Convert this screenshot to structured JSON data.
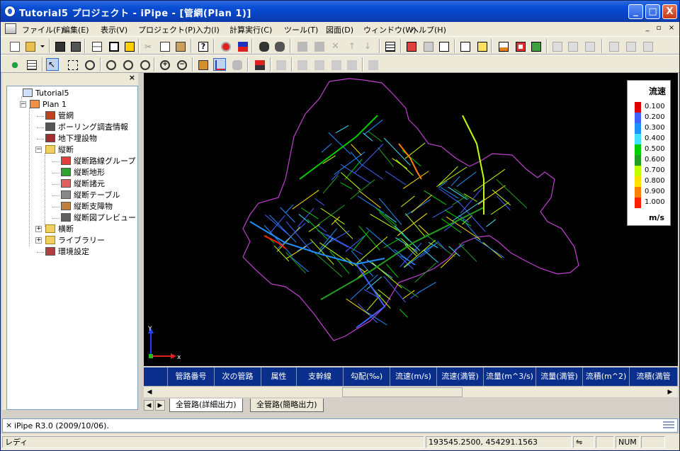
{
  "window": {
    "title": "Tutorial5 プロジェクト - iPipe - [管網(Plan 1)]",
    "buttons": {
      "minimize": "_",
      "maximize": "□",
      "close": "X"
    }
  },
  "menu": {
    "items": [
      "ファイル(F)",
      "編集(E)",
      "表示(V)",
      "プロジェクト(P)",
      "入力(I)",
      "計算実行(C)",
      "ツール(T)",
      "図面(D)",
      "ウィンドウ(W)",
      "ヘルプ(H)"
    ],
    "mdi": [
      "_",
      "▫",
      "×"
    ]
  },
  "left_panel": {
    "close": "×",
    "tree": [
      {
        "label": "Tutorial5",
        "icon": "project-icon",
        "level": 0,
        "expander": ""
      },
      {
        "label": "Plan 1",
        "icon": "plan-icon",
        "level": 1,
        "expander": "−"
      },
      {
        "label": "管網",
        "icon": "network-icon",
        "level": 2,
        "expander": ""
      },
      {
        "label": "ボーリング調査情報",
        "icon": "boring-icon",
        "level": 2,
        "expander": ""
      },
      {
        "label": "地下埋設物",
        "icon": "buried-icon",
        "level": 2,
        "expander": ""
      },
      {
        "label": "縦断",
        "icon": "folder-icon",
        "level": 2,
        "expander": "−"
      },
      {
        "label": "縦断路線グループ",
        "icon": "route-group-icon",
        "level": 3,
        "expander": ""
      },
      {
        "label": "縦断地形",
        "icon": "terrain-icon",
        "level": 3,
        "expander": ""
      },
      {
        "label": "縦断諸元",
        "icon": "spec-icon",
        "level": 3,
        "expander": ""
      },
      {
        "label": "縦断テーブル",
        "icon": "table-icon",
        "level": 3,
        "expander": ""
      },
      {
        "label": "縦断支障物",
        "icon": "obstacle-icon",
        "level": 3,
        "expander": ""
      },
      {
        "label": "縦断図プレビュー",
        "icon": "preview-icon",
        "level": 3,
        "expander": ""
      },
      {
        "label": "横断",
        "icon": "folder-icon",
        "level": 2,
        "expander": "+"
      },
      {
        "label": "ライブラリー",
        "icon": "folder-icon",
        "level": 2,
        "expander": "+"
      },
      {
        "label": "環境設定",
        "icon": "settings-icon",
        "level": 2,
        "expander": ""
      }
    ]
  },
  "legend": {
    "title": "流速",
    "unit": "m/s",
    "items": [
      {
        "label": "0.100",
        "color": "#e00000"
      },
      {
        "label": "0.200",
        "color": "#4060ff"
      },
      {
        "label": "0.300",
        "color": "#2090ff"
      },
      {
        "label": "0.400",
        "color": "#40e0ff"
      },
      {
        "label": "0.500",
        "color": "#00d000"
      },
      {
        "label": "0.600",
        "color": "#20a020"
      },
      {
        "label": "0.700",
        "color": "#c0ff00"
      },
      {
        "label": "0.800",
        "color": "#ffe000"
      },
      {
        "label": "0.900",
        "color": "#ff8000"
      },
      {
        "label": "1.000",
        "color": "#ff2000"
      }
    ]
  },
  "axes": {
    "y": "Y",
    "x": "x"
  },
  "grid": {
    "columns": [
      "",
      "管路番号",
      "次の管路",
      "属性",
      "支幹線",
      "勾配(‰)",
      "流速(m/s)",
      "流速(満管)",
      "流量(m^3/s)",
      "流量(満管)",
      "流積(m^2)",
      "流積(満管"
    ]
  },
  "tabs": [
    "全管路(詳細出力)",
    "全管路(簡略出力)"
  ],
  "output": {
    "close": "×",
    "text": "iPipe R3.0 (2009/10/06)."
  },
  "status": {
    "ready": "レディ",
    "coords": "193545.2500, 454291.1563",
    "num": "NUM"
  },
  "colors": {
    "map_boundary": "#c040d0",
    "titlebar": "#0a4fd6",
    "grid_header": "#0a2e8c"
  }
}
